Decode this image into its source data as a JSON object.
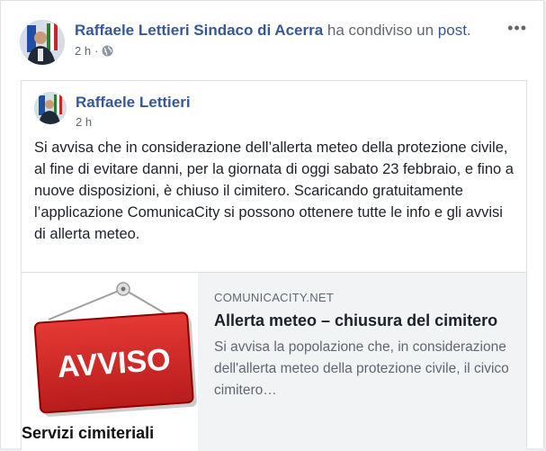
{
  "post": {
    "author": "Raffaele Lettieri Sindaco di Acerra",
    "share_text": " ha condiviso un ",
    "share_link": "post",
    "share_end": ".",
    "time": "2 h",
    "privacy_icon": "globe-icon",
    "more_label": "•••"
  },
  "shared": {
    "author": "Raffaele Lettieri",
    "time": "2 h",
    "text": "Si avvisa che in considerazione dell’allerta meteo della protezione civile, al fine di evitare danni, per la giornata di oggi sabato 23 febbraio, e fino a nuove disposizioni, è chiuso il cimitero. Scaricando gratuitamente l’applicazione ComunicaCity si possono ottenere tutte le info e gli avvisi di allerta meteo."
  },
  "link_card": {
    "domain": "COMUNICACITY.NET",
    "title": "Allerta meteo – chiusura del cimitero",
    "description": "Si avvisa la popolazione che, in considerazione dell'allerta meteo della protezione civile, il civico cimitero…",
    "image": {
      "sign_text": "AVVISO",
      "caption": "Servizi cimiteriali"
    }
  },
  "colors": {
    "link_blue": "#365899",
    "sign_red": "#c62828"
  }
}
